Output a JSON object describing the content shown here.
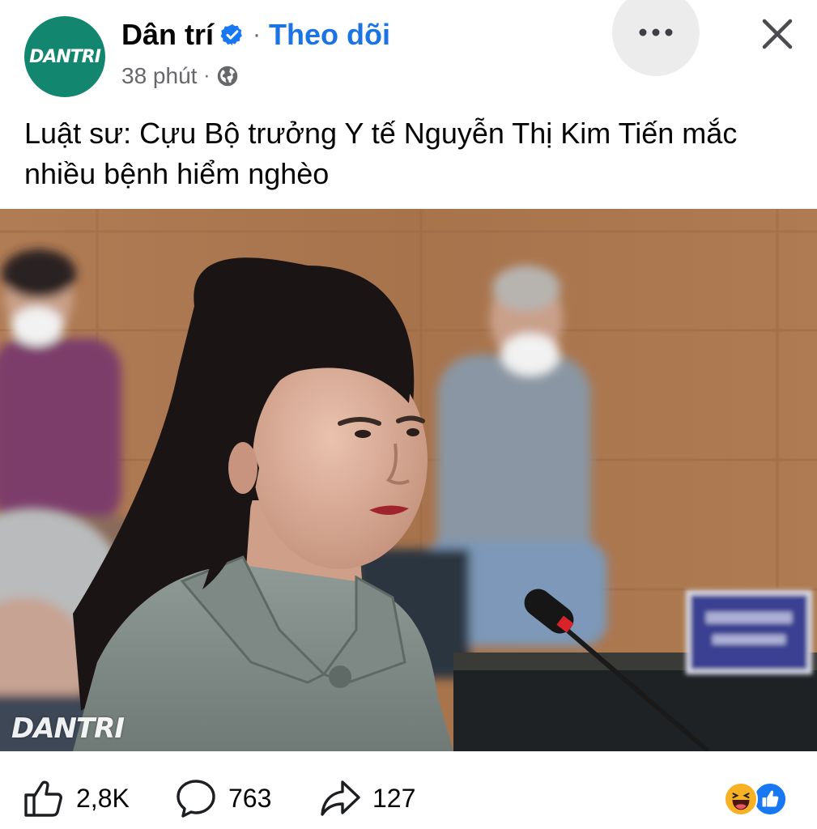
{
  "header": {
    "avatar_text": "DANTRI",
    "page_name": "Dân trí",
    "verified_icon": "verified-badge-icon",
    "separator": "·",
    "follow_label": "Theo dõi",
    "time": "38 phút",
    "meta_separator": "·",
    "privacy_icon": "globe-icon",
    "more_icon": "more-icon",
    "close_icon": "close-icon"
  },
  "post": {
    "text": "Luật sư: Cựu Bộ trưởng Y tế Nguyễn Thị Kim Tiến mắc nhiều bệnh hiểm nghèo",
    "photo_watermark": "DANTRI"
  },
  "actions": {
    "likes": "2,8K",
    "comments": "763",
    "shares": "127",
    "reaction_icons": [
      "haha-reaction-icon",
      "like-reaction-icon"
    ]
  },
  "colors": {
    "brand_green": "#13866f",
    "link_blue": "#1b74e4",
    "secondary_text": "#65676b"
  }
}
